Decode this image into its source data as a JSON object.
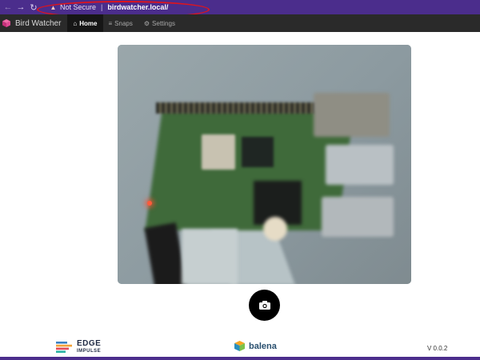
{
  "browser": {
    "not_secure_label": "Not Secure",
    "separator": "|",
    "url": "birdwatcher.local/"
  },
  "app": {
    "title": "Bird Watcher",
    "nav": [
      {
        "label": "Home",
        "icon": "home-icon",
        "active": true
      },
      {
        "label": "Snaps",
        "icon": "list-icon",
        "active": false
      },
      {
        "label": "Settings",
        "icon": "gear-icon",
        "active": false
      }
    ]
  },
  "main": {
    "feed_icon": "camera-feed",
    "snap_button_icon": "camera-icon"
  },
  "footer": {
    "edge_line1": "EDGE",
    "edge_line2": "IMPULSE",
    "balena": "balena",
    "version": "V 0.0.2"
  },
  "colors": {
    "browser_bar": "#4b2d8c",
    "app_nav": "#2a2a2a",
    "annotation": "#e0141c"
  }
}
